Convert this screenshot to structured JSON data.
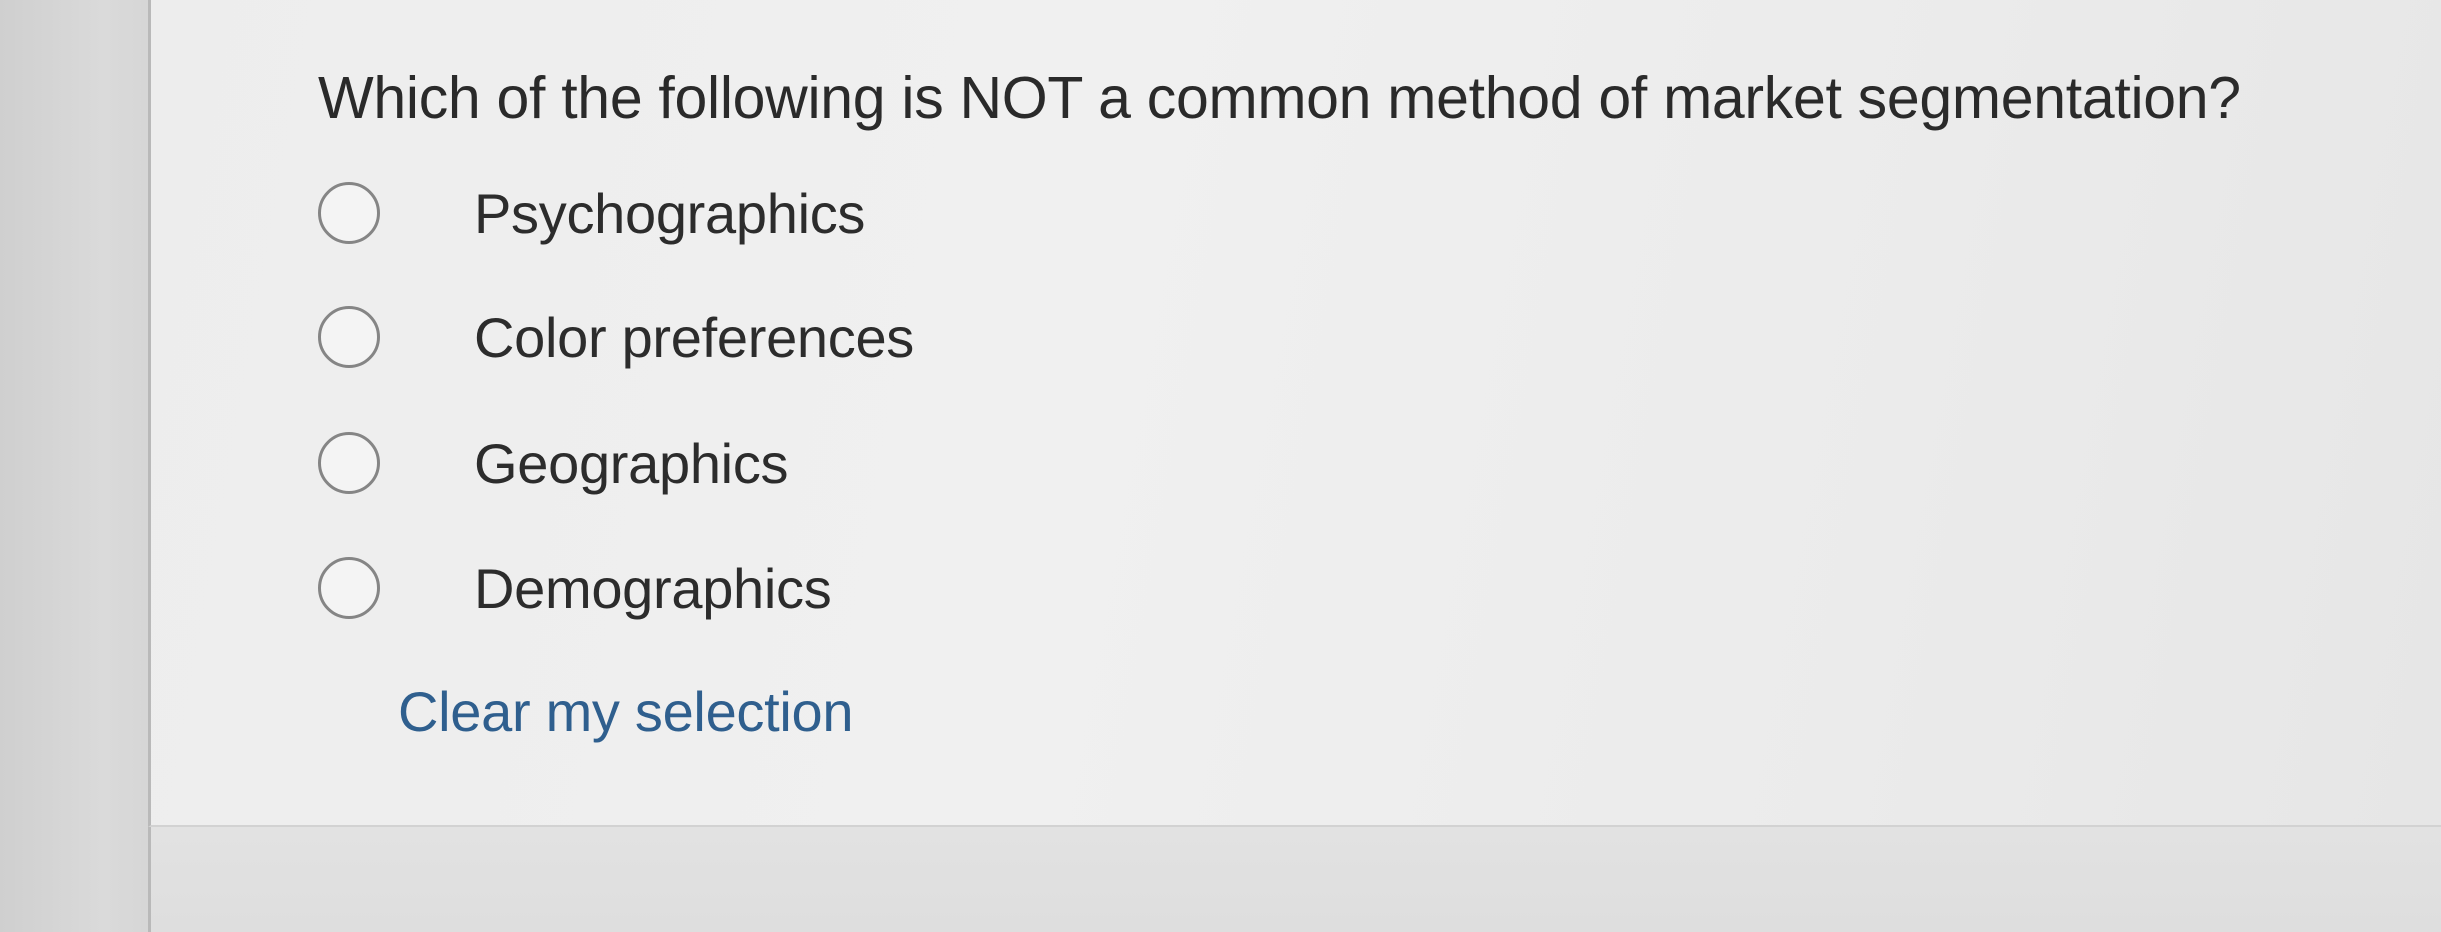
{
  "question": {
    "text": "Which of the following is NOT a common method of market segmentation?"
  },
  "options": [
    {
      "label": "Psychographics",
      "selected": false
    },
    {
      "label": "Color preferences",
      "selected": false
    },
    {
      "label": "Geographics",
      "selected": false
    },
    {
      "label": "Demographics",
      "selected": false
    }
  ],
  "clear_link": {
    "label": "Clear my selection",
    "color": "#2f5f8e"
  }
}
